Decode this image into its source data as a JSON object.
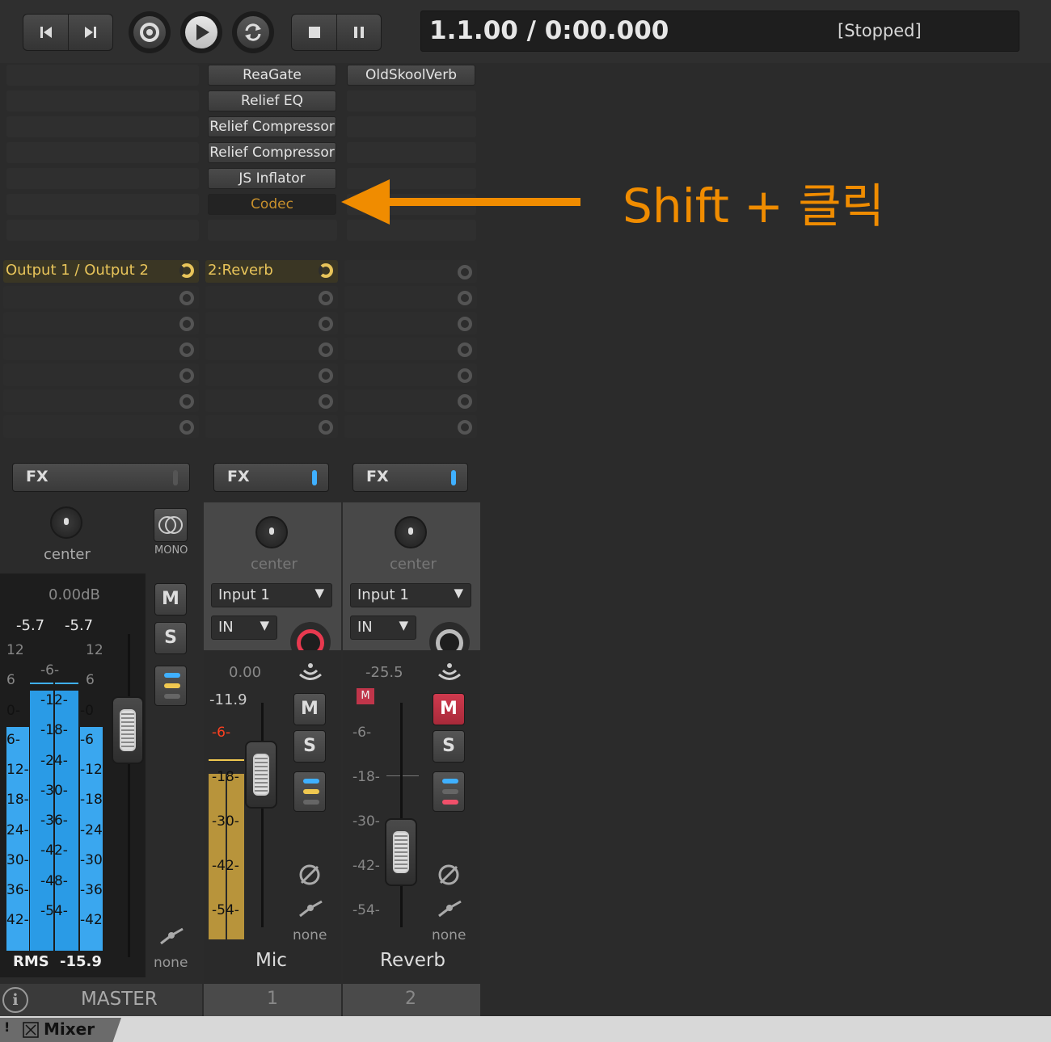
{
  "transport": {
    "time": "1.1.00 / 0:00.000",
    "status": "[Stopped]"
  },
  "fx_chain": {
    "track1": [
      "ReaGate",
      "Relief EQ",
      "Relief Compressor",
      "Relief Compressor",
      "JS Inflator",
      "Codec"
    ],
    "track2": [
      "OldSkoolVerb"
    ]
  },
  "annotation": {
    "text": "Shift + 클릭",
    "color": "#f08c00"
  },
  "sends": {
    "master": "Output 1 / Output 2",
    "track1": "2:Reverb"
  },
  "strips": {
    "master": {
      "fx_label": "FX",
      "pan": "center",
      "mono_label": "MONO",
      "volume": "0.00dB",
      "peak_l": "-5.7",
      "peak_r": "-5.7",
      "mute": "M",
      "solo": "S",
      "rms_label": "RMS",
      "rms_value": "-15.9",
      "automation": "none",
      "name": "MASTER",
      "info_icon": "i",
      "scale_left": [
        "12",
        "6",
        "0-",
        "6-",
        "12-",
        "18-",
        "24-",
        "30-",
        "36-",
        "42-"
      ],
      "scale_right": [
        "12",
        "6",
        "-0",
        "-6",
        "-12",
        "-18",
        "-24",
        "-30",
        "-36",
        "-42"
      ],
      "scale_mid": [
        "-6-",
        "-12-",
        "-18-",
        "-24-",
        "-30-",
        "-36-",
        "-42-",
        "-48-",
        "-54-"
      ]
    },
    "mic": {
      "fx_label": "FX",
      "pan": "center",
      "input": "Input 1",
      "monitor": "IN",
      "volume": "0.00",
      "peak": "-11.9",
      "mute": "M",
      "solo": "S",
      "automation": "none",
      "name": "Mic",
      "number": "1",
      "scale": [
        "-6-",
        "-18-",
        "-30-",
        "-42-",
        "-54-"
      ]
    },
    "reverb": {
      "fx_label": "FX",
      "pan": "center",
      "input": "Input 1",
      "monitor": "IN",
      "volume": "-25.5",
      "mute_indicator": "M",
      "mute": "M",
      "solo": "S",
      "automation": "none",
      "name": "Reverb",
      "number": "2",
      "scale": [
        "-6-",
        "-18-",
        "-30-",
        "-42-",
        "-54-"
      ]
    }
  },
  "footer": {
    "tab": "Mixer",
    "bang": "!"
  }
}
